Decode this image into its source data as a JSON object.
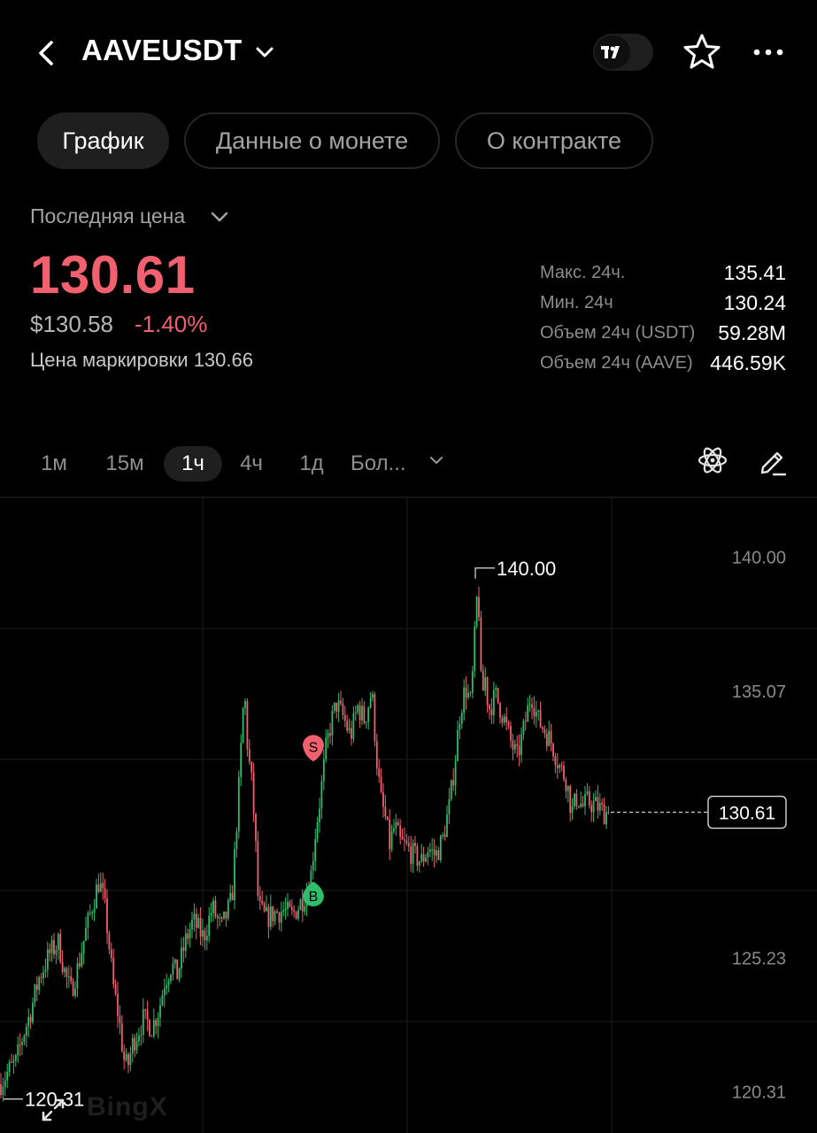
{
  "header": {
    "title": "AAVEUSDT",
    "icons": [
      "back-arrow-icon",
      "chevron-down-icon",
      "tradingview-icon",
      "star-icon",
      "more-icon"
    ]
  },
  "tabs": [
    {
      "label": "График",
      "active": true
    },
    {
      "label": "Данные о монете",
      "active": false
    },
    {
      "label": "О контракте",
      "active": false
    }
  ],
  "price": {
    "label": "Последняя цена",
    "last": "130.61",
    "usd": "$130.58",
    "change": "-1.40%",
    "mark_label": "Цена маркировки 130.66",
    "color_down": "#f0606e",
    "color_up": "#2ebd6b"
  },
  "stats": [
    {
      "label": "Макс. 24ч.",
      "value": "135.41"
    },
    {
      "label": "Мин. 24ч",
      "value": "130.24"
    },
    {
      "label": "Объем 24ч (USDT)",
      "value": "59.28M"
    },
    {
      "label": "Объем 24ч (AAVE)",
      "value": "446.59K"
    }
  ],
  "intervals": [
    {
      "label": "1м",
      "active": false
    },
    {
      "label": "15м",
      "active": false
    },
    {
      "label": "1ч",
      "active": true
    },
    {
      "label": "4ч",
      "active": false
    },
    {
      "label": "1д",
      "active": false
    },
    {
      "label": "Бол...",
      "active": false
    }
  ],
  "chart_data": {
    "type": "candlestick",
    "y_axis_labels": [
      "140.00",
      "135.07",
      "125.23",
      "120.31"
    ],
    "ylim": [
      118.8,
      142.2
    ],
    "max_marker": "140.00",
    "min_marker": "120.31",
    "current_price": "130.61",
    "trade_markers": [
      {
        "label": "S",
        "price": 133.0
      },
      {
        "label": "B",
        "price": 127.6
      }
    ],
    "trend_x": [
      0,
      10,
      18,
      26,
      34,
      44,
      56,
      66,
      74,
      80,
      88,
      96,
      106,
      112,
      118,
      122,
      128,
      134,
      140,
      144,
      150,
      162,
      172,
      180,
      186,
      194,
      200,
      210,
      218,
      230,
      240,
      250,
      262,
      270,
      276,
      280,
      284,
      288,
      292,
      300,
      310,
      320,
      330,
      340,
      350,
      356,
      362,
      368,
      374,
      380,
      388,
      396,
      404,
      412,
      420,
      426,
      430,
      436,
      440,
      446,
      452,
      460,
      468,
      476,
      484,
      492,
      500,
      508,
      514,
      520,
      526,
      532,
      536,
      540,
      544,
      548,
      552,
      560,
      568,
      576,
      584,
      592,
      600,
      608,
      616,
      624,
      632,
      640,
      646,
      652,
      658,
      664,
      670,
      676,
      682,
      688
    ],
    "trend_y": [
      120.6,
      121.1,
      121.4,
      122.4,
      123.2,
      124.5,
      125.4,
      125.8,
      124.6,
      124.0,
      124.9,
      126.1,
      127.4,
      128.1,
      127.2,
      126.1,
      124.2,
      123.1,
      121.5,
      121.2,
      122.1,
      123.0,
      122.7,
      123.4,
      124.4,
      125.0,
      124.6,
      125.9,
      126.6,
      126.0,
      127.1,
      126.3,
      127.4,
      131.6,
      135.2,
      132.8,
      131.8,
      130.0,
      127.1,
      126.7,
      126.9,
      127.0,
      126.8,
      127.3,
      127.9,
      129.8,
      131.2,
      132.9,
      133.9,
      134.6,
      134.1,
      133.4,
      134.5,
      134.0,
      135.1,
      132.4,
      131.1,
      130.3,
      129.4,
      130.1,
      129.5,
      129.3,
      129.0,
      128.8,
      129.3,
      129.0,
      129.6,
      130.9,
      132.5,
      134.4,
      135.2,
      134.6,
      136.9,
      139.2,
      134.7,
      135.6,
      134.4,
      134.9,
      134.2,
      133.3,
      132.6,
      133.7,
      135.0,
      134.0,
      133.6,
      133.1,
      132.3,
      131.8,
      130.6,
      131.2,
      130.8,
      131.0,
      130.9,
      130.8,
      130.6,
      130.61
    ]
  }
}
